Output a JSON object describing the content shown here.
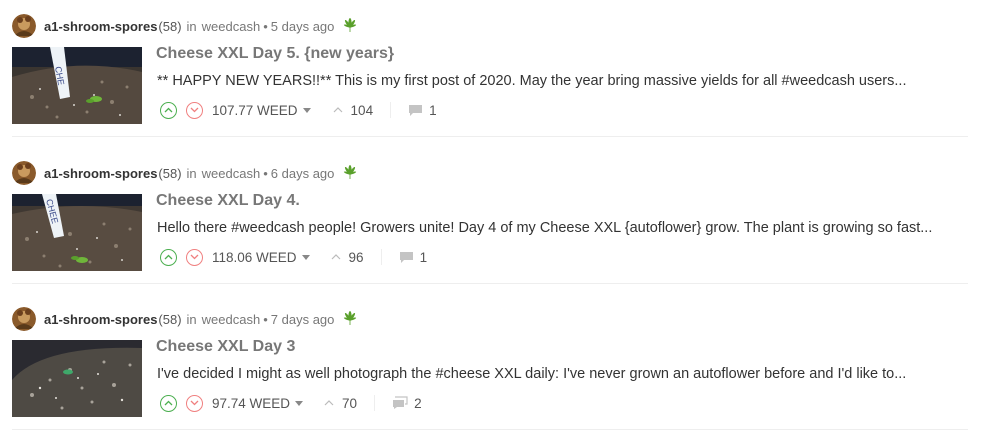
{
  "posts": [
    {
      "author": "a1-shroom-spores",
      "reputation": "(58)",
      "in_label": "in",
      "community": "weedcash",
      "time": "5 days ago",
      "title": "Cheese XXL Day 5. {new years}",
      "body": "** HAPPY NEW YEARS!!** This is my first post of 2020. May the year bring massive yields for all #weedcash users...",
      "payout": "107.77 WEED",
      "votes": "104",
      "comments": "1"
    },
    {
      "author": "a1-shroom-spores",
      "reputation": "(58)",
      "in_label": "in",
      "community": "weedcash",
      "time": "6 days ago",
      "title": "Cheese XXL Day 4.",
      "body": "Hello there #weedcash people! Growers unite! Day 4 of my Cheese XXL {autoflower} grow. The plant is growing so fast...",
      "payout": "118.06 WEED",
      "votes": "96",
      "comments": "1"
    },
    {
      "author": "a1-shroom-spores",
      "reputation": "(58)",
      "in_label": "in",
      "community": "weedcash",
      "time": "7 days ago",
      "title": "Cheese XXL Day 3",
      "body": "I've decided I might as well photograph the #cheese XXL daily: I've never grown an autoflower before and I'd like to...",
      "payout": "97.74 WEED",
      "votes": "70",
      "comments": "2"
    }
  ],
  "icons": {
    "upvote": "chevron-up-circle-icon",
    "downvote": "chevron-down-circle-icon",
    "votes": "chevron-up-icon",
    "comments": "comment-bubble-icon",
    "community": "cannabis-leaf-icon"
  },
  "colors": {
    "upvote": "#4caf50",
    "downvote": "#f08080",
    "title": "#777777",
    "leaf": "#5aa02c"
  }
}
